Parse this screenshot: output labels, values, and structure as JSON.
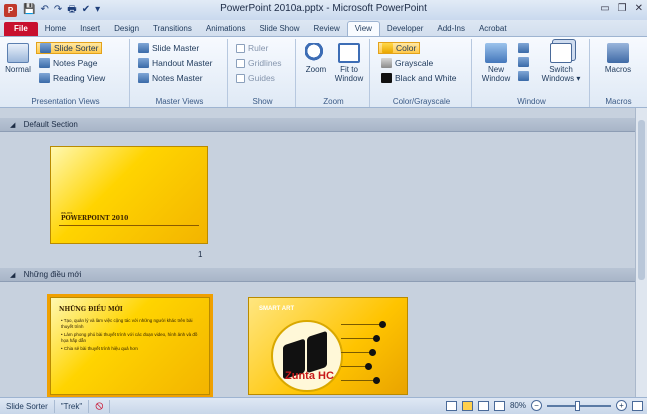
{
  "titlebar": {
    "app_icon_letter": "P",
    "title": "PowerPoint 2010a.pptx - Microsoft PowerPoint",
    "qat": [
      "💾",
      "↶",
      "↷",
      "🖶",
      "✔",
      "▾"
    ],
    "controls": [
      "▭",
      "❐",
      "✕"
    ]
  },
  "tabs": [
    {
      "label": "File",
      "state": "file"
    },
    {
      "label": "Home",
      "state": ""
    },
    {
      "label": "Insert",
      "state": ""
    },
    {
      "label": "Design",
      "state": ""
    },
    {
      "label": "Transitions",
      "state": ""
    },
    {
      "label": "Animations",
      "state": ""
    },
    {
      "label": "Slide Show",
      "state": ""
    },
    {
      "label": "Review",
      "state": ""
    },
    {
      "label": "View",
      "state": "active"
    },
    {
      "label": "Developer",
      "state": ""
    },
    {
      "label": "Add-Ins",
      "state": ""
    },
    {
      "label": "Acrobat",
      "state": ""
    }
  ],
  "ribbon": {
    "presentation_views": {
      "normal": "Normal",
      "slide_sorter": "Slide Sorter",
      "notes_page": "Notes Page",
      "reading_view": "Reading View",
      "label": "Presentation Views"
    },
    "master_views": {
      "slide_master": "Slide Master",
      "handout_master": "Handout Master",
      "notes_master": "Notes Master",
      "label": "Master Views"
    },
    "show": {
      "ruler": "Ruler",
      "gridlines": "Gridlines",
      "guides": "Guides",
      "label": "Show"
    },
    "zoom": {
      "zoom": "Zoom",
      "fit_line1": "Fit to",
      "fit_line2": "Window",
      "label": "Zoom"
    },
    "color": {
      "color": "Color",
      "grayscale": "Grayscale",
      "black_white": "Black and White",
      "label": "Color/Grayscale"
    },
    "window": {
      "new_line1": "New",
      "new_line2": "Window",
      "switch_line1": "Switch",
      "switch_line2": "Windows ▾",
      "label": "Window"
    },
    "macros": {
      "macros": "Macros",
      "label": "Macros"
    }
  },
  "sections": [
    {
      "name": "Default Section"
    },
    {
      "name": "Những điều mới"
    }
  ],
  "slides": {
    "s1": {
      "title": "POWERPOINT 2010",
      "sub": "ws.ms",
      "number": "1"
    },
    "s2": {
      "title": "NHỮNG ĐIỀU MỚI",
      "bullets": [
        "• Tạo, quản lý và làm việc cộng tác với những người khác trên bài thuyết trình",
        "• Làm phong phú bài thuyết trình với các đoạn video, hình ảnh và đồ họa hấp dẫn",
        "• Chia sẻ bài thuyết trình hiệu quả hơn"
      ]
    },
    "s3": {
      "title": "SMART ART",
      "mark": "Zunta HC"
    }
  },
  "statusbar": {
    "view": "Slide Sorter",
    "theme": "\"Trek\"",
    "proof_icon": "🛇",
    "zoom": "80%",
    "zoom_minus": "−",
    "zoom_plus": "+"
  }
}
